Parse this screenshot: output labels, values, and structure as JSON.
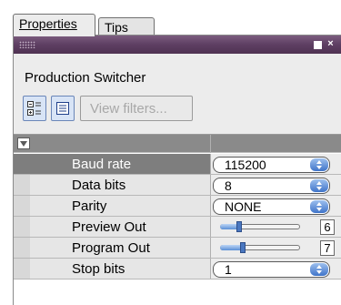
{
  "tabs": [
    {
      "label": "Properties"
    },
    {
      "label": "Tips"
    }
  ],
  "panel": {
    "title": "Production Switcher",
    "toolbar": {
      "categorized_icon": "categorized-view-icon",
      "alphabetical_icon": "alphabetical-view-icon",
      "filter_label": "View filters..."
    }
  },
  "properties": [
    {
      "name": "Baud rate",
      "type": "combo",
      "value": "115200",
      "selected": true
    },
    {
      "name": "Data bits",
      "type": "combo",
      "value": "8"
    },
    {
      "name": "Parity",
      "type": "combo",
      "value": "NONE"
    },
    {
      "name": "Preview Out",
      "type": "slider",
      "value": "6",
      "level": 0.24
    },
    {
      "name": "Program Out",
      "type": "slider",
      "value": "7",
      "level": 0.28
    },
    {
      "name": "Stop bits",
      "type": "combo",
      "value": "1"
    }
  ],
  "colors": {
    "titlebar": "#5e3f63",
    "selected_row": "#7e7e7e",
    "accent_blue": "#3f74c9"
  }
}
